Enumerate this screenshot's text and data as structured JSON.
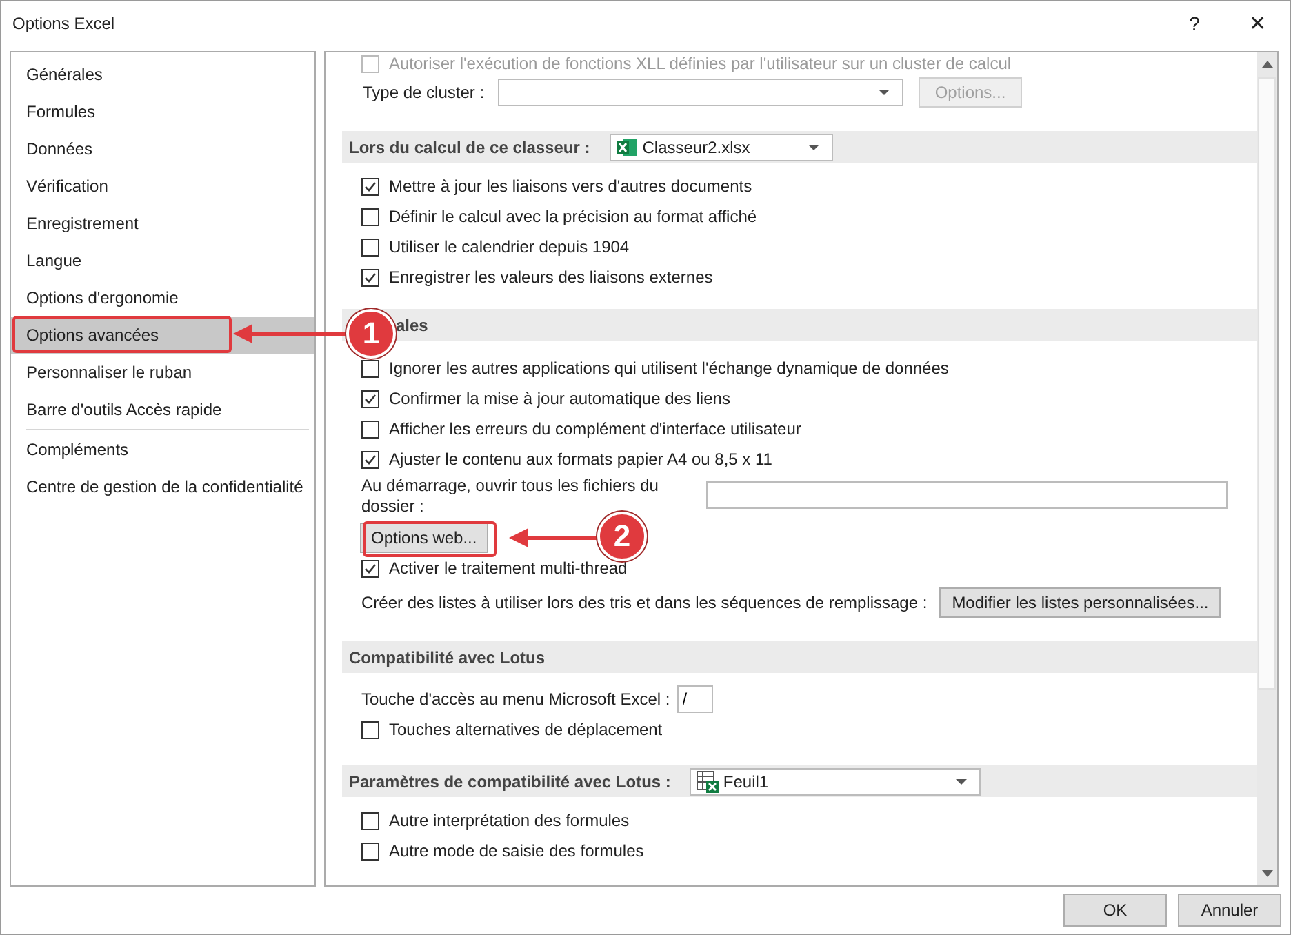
{
  "window": {
    "title": "Options Excel",
    "help": "?",
    "close": "✕"
  },
  "sidebar": {
    "groups": [
      [
        {
          "label": "Générales",
          "selected": false
        },
        {
          "label": "Formules",
          "selected": false
        },
        {
          "label": "Données",
          "selected": false
        },
        {
          "label": "Vérification",
          "selected": false
        },
        {
          "label": "Enregistrement",
          "selected": false
        },
        {
          "label": "Langue",
          "selected": false
        },
        {
          "label": "Options d'ergonomie",
          "selected": false
        },
        {
          "label": "Options avancées",
          "selected": true
        },
        {
          "label": "Personnaliser le ruban",
          "selected": false
        },
        {
          "label": "Barre d'outils Accès rapide",
          "selected": false
        }
      ],
      [
        {
          "label": "Compléments",
          "selected": false
        },
        {
          "label": "Centre de gestion de la confidentialité",
          "selected": false
        }
      ]
    ]
  },
  "content": [
    {
      "kind": "checkbox",
      "label": "Autoriser l'exécution de fonctions XLL définies par l'utilisateur sur un cluster de calcul",
      "checked": false,
      "disabled": true
    },
    {
      "kind": "select-row",
      "label": "Type de cluster :",
      "button": "Options...",
      "disabled": true
    },
    {
      "kind": "header",
      "label": "Lors du calcul de ce classeur :",
      "select": {
        "value": "Classeur2.xlsx",
        "kind": "workbook"
      }
    },
    {
      "kind": "checkbox",
      "label": "Mettre à jour les liaisons vers d'autres documents",
      "checked": true,
      "disabled": false
    },
    {
      "kind": "checkbox",
      "label": "Définir le calcul avec la précision au format affiché",
      "checked": false,
      "disabled": false
    },
    {
      "kind": "checkbox",
      "label": "Utiliser le calendrier depuis 1904",
      "checked": false,
      "disabled": false
    },
    {
      "kind": "checkbox",
      "label": "Enregistrer les valeurs des liaisons externes",
      "checked": true,
      "disabled": false
    },
    {
      "kind": "header",
      "label": "ales"
    },
    {
      "kind": "checkbox",
      "label": "Ignorer les autres applications qui utilisent l'échange dynamique de données",
      "checked": false,
      "disabled": false
    },
    {
      "kind": "checkbox",
      "label": "Confirmer la mise à jour automatique des liens",
      "checked": true,
      "disabled": false
    },
    {
      "kind": "checkbox",
      "label": "Afficher les erreurs du complément d'interface utilisateur",
      "checked": false,
      "disabled": false
    },
    {
      "kind": "checkbox",
      "label": "Ajuster le contenu aux formats papier A4 ou 8,5 x 11",
      "checked": true,
      "disabled": false
    },
    {
      "kind": "folder-field",
      "label": "Au démarrage, ouvrir tous les fichiers du dossier :"
    },
    {
      "kind": "button",
      "label": "Options web..."
    },
    {
      "kind": "checkbox",
      "label": "Activer le traitement multi-thread",
      "checked": true,
      "disabled": false
    },
    {
      "kind": "button-row",
      "label": "Créer des listes à utiliser lors des tris et dans les séquences de remplissage :",
      "button": "Modifier les listes personnalisées..."
    },
    {
      "kind": "header",
      "label": "Compatibilité avec Lotus"
    },
    {
      "kind": "text-field",
      "label": "Touche d'accès au menu  Microsoft Excel :",
      "value": "/"
    },
    {
      "kind": "checkbox",
      "label": "Touches alternatives de déplacement",
      "checked": false,
      "disabled": false
    },
    {
      "kind": "header",
      "label": "Paramètres de compatibilité avec Lotus :",
      "select": {
        "value": "Feuil1",
        "kind": "sheet"
      }
    },
    {
      "kind": "checkbox",
      "label": "Autre interprétation des formules",
      "checked": false,
      "disabled": false
    },
    {
      "kind": "checkbox",
      "label": "Autre mode de saisie des formules",
      "checked": false,
      "disabled": false
    }
  ],
  "buttons": [
    "OK",
    "Annuler"
  ],
  "annotations": [
    {
      "label": "1",
      "kind": "sidebar"
    },
    {
      "label": "2",
      "kind": "content"
    }
  ]
}
